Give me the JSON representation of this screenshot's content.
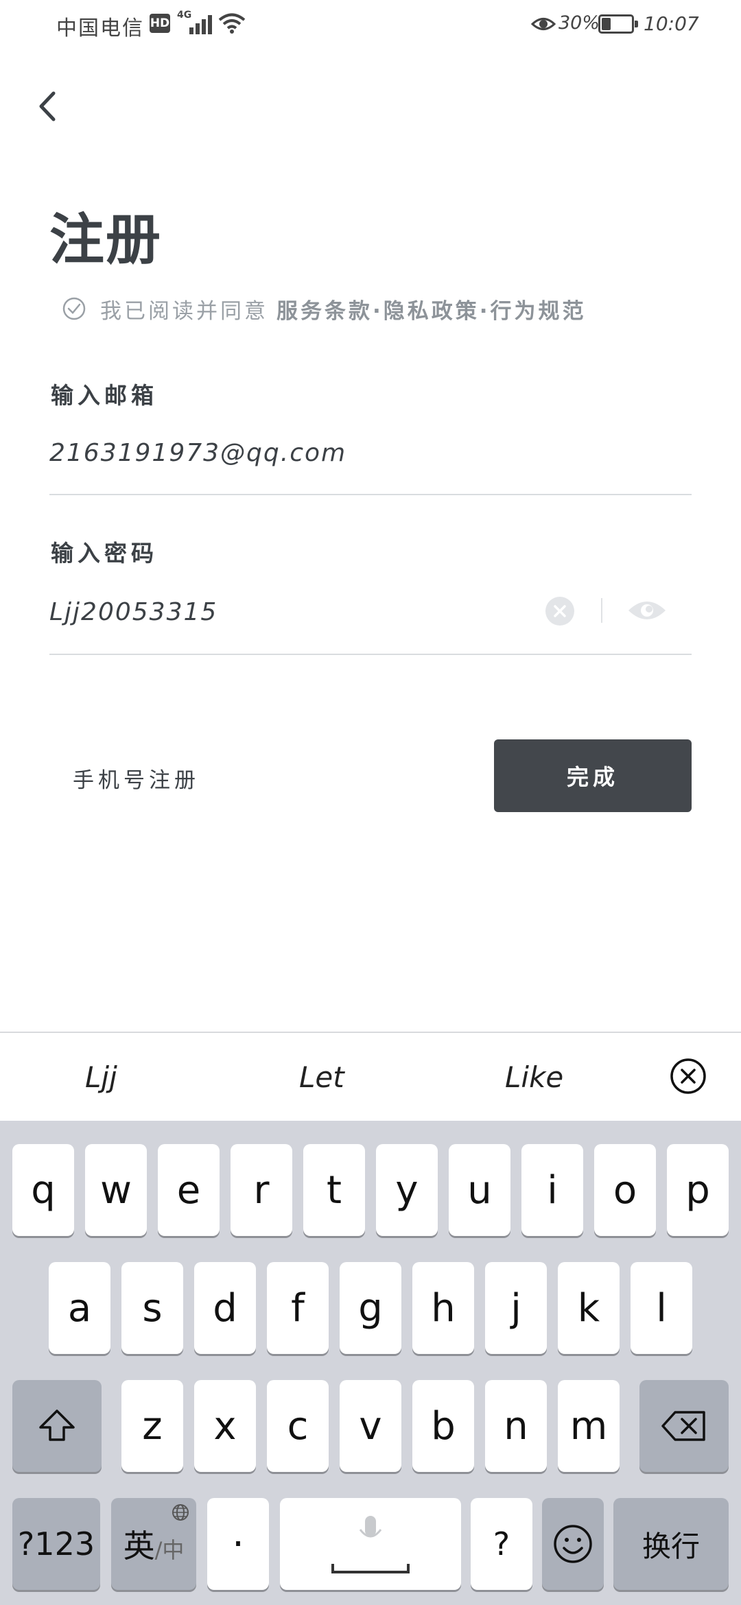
{
  "status_bar": {
    "carrier": "中国电信",
    "hd_badge": "HD",
    "network": "4G",
    "battery_percent": "30%",
    "battery_level": 0.3,
    "time": "10:07"
  },
  "header": {
    "title": "注册"
  },
  "agreement": {
    "prefix": "我已阅读并同意",
    "links": "服务条款·隐私政策·行为规范",
    "checked": true
  },
  "email": {
    "label": "输入邮箱",
    "value": "2163191973@qq.com"
  },
  "password": {
    "label": "输入密码",
    "value": "Ljj20053315"
  },
  "actions": {
    "phone_register": "手机号注册",
    "done": "完成"
  },
  "suggestions": [
    "Ljj",
    "Let",
    "Like"
  ],
  "keyboard": {
    "row1": [
      "q",
      "w",
      "e",
      "r",
      "t",
      "y",
      "u",
      "i",
      "o",
      "p"
    ],
    "row2": [
      "a",
      "s",
      "d",
      "f",
      "g",
      "h",
      "j",
      "k",
      "l"
    ],
    "row3": [
      "z",
      "x",
      "c",
      "v",
      "b",
      "n",
      "m"
    ],
    "num_key": "?123",
    "lang_key_main": "英",
    "lang_key_sub": "/中",
    "dot_key": "·",
    "question_key": "?",
    "enter_key": "换行"
  },
  "colors": {
    "accent_dark": "#43474c",
    "muted_text": "#9aa0a6",
    "keyboard_bg": "#d2d4db"
  }
}
